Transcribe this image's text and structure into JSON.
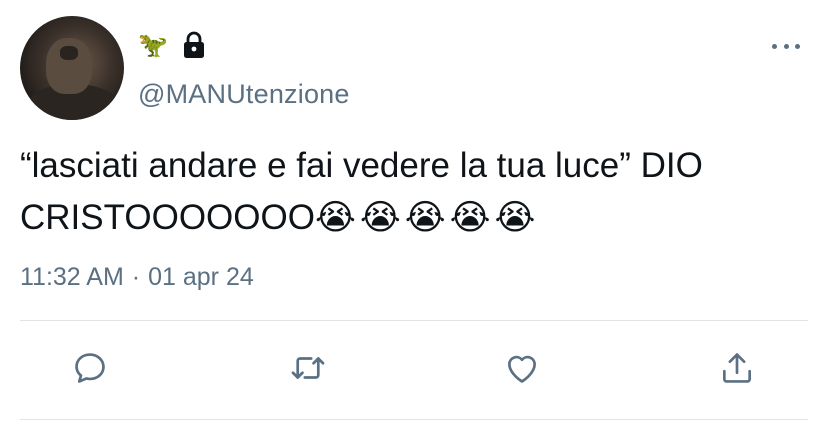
{
  "user": {
    "name_emoji": "🦖",
    "handle": "@MANUtenzione",
    "protected_icon": "lock-icon"
  },
  "tweet": {
    "text": "“lasciati andare e fai vedere la tua luce” DIO CRISTOOOOOOO",
    "emojis": "😭😭😭😭😭",
    "time": "11:32 AM",
    "separator": "·",
    "date": "01 apr 24"
  },
  "actions": {
    "reply_icon": "reply-icon",
    "retweet_icon": "retweet-icon",
    "like_icon": "heart-icon",
    "share_icon": "share-icon"
  },
  "colors": {
    "text": "#0f1419",
    "secondary": "#5b7083",
    "divider": "#dfe3e6"
  }
}
